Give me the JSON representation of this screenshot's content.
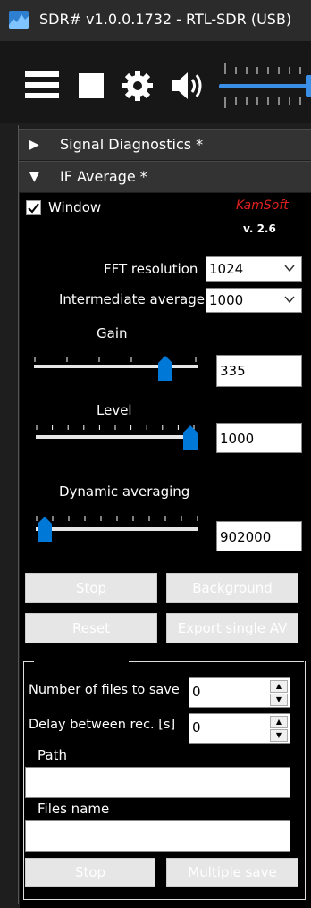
{
  "window": {
    "title": "SDR# v1.0.0.1732 - RTL-SDR (USB)"
  },
  "toolbar": {
    "menu_icon": "hamburger-menu-icon",
    "stop_icon": "stop-icon",
    "settings_icon": "gear-icon",
    "audio_icon": "speaker-icon"
  },
  "sections": [
    {
      "label": "Signal Diagnostics *",
      "expanded": false
    },
    {
      "label": "IF Average *",
      "expanded": true
    }
  ],
  "if_average": {
    "window_checkbox": {
      "label": "Window",
      "checked": true
    },
    "brand": "KamSoft",
    "version": "v. 2.6",
    "fft_resolution": {
      "label": "FFT resolution",
      "value": "1024"
    },
    "intermediate_average": {
      "label": "Intermediate average",
      "value": "1000"
    },
    "gain": {
      "label": "Gain",
      "value": "335",
      "fraction": 0.8
    },
    "level": {
      "label": "Level",
      "value": "1000",
      "fraction": 1.0
    },
    "dynamic_averaging": {
      "label": "Dynamic averaging",
      "value": "902000",
      "fraction": 0.03
    },
    "buttons": {
      "stop": "Stop",
      "background": "Background",
      "reset": "Reset",
      "export_single_av": "Export single AV"
    }
  },
  "multi_save": {
    "num_files_label": "Number of files to save",
    "num_files_value": "0",
    "delay_label": "Delay between rec. [s]",
    "delay_value": "0",
    "path_label": "Path",
    "path_value": "",
    "files_name_label": "Files name",
    "files_name_value": "",
    "stop_button": "Stop",
    "multiple_save_button": "Multiple save"
  },
  "colors": {
    "accent": "#0078d7",
    "brand": "#e02020",
    "disabled_text": "#ffffff"
  }
}
